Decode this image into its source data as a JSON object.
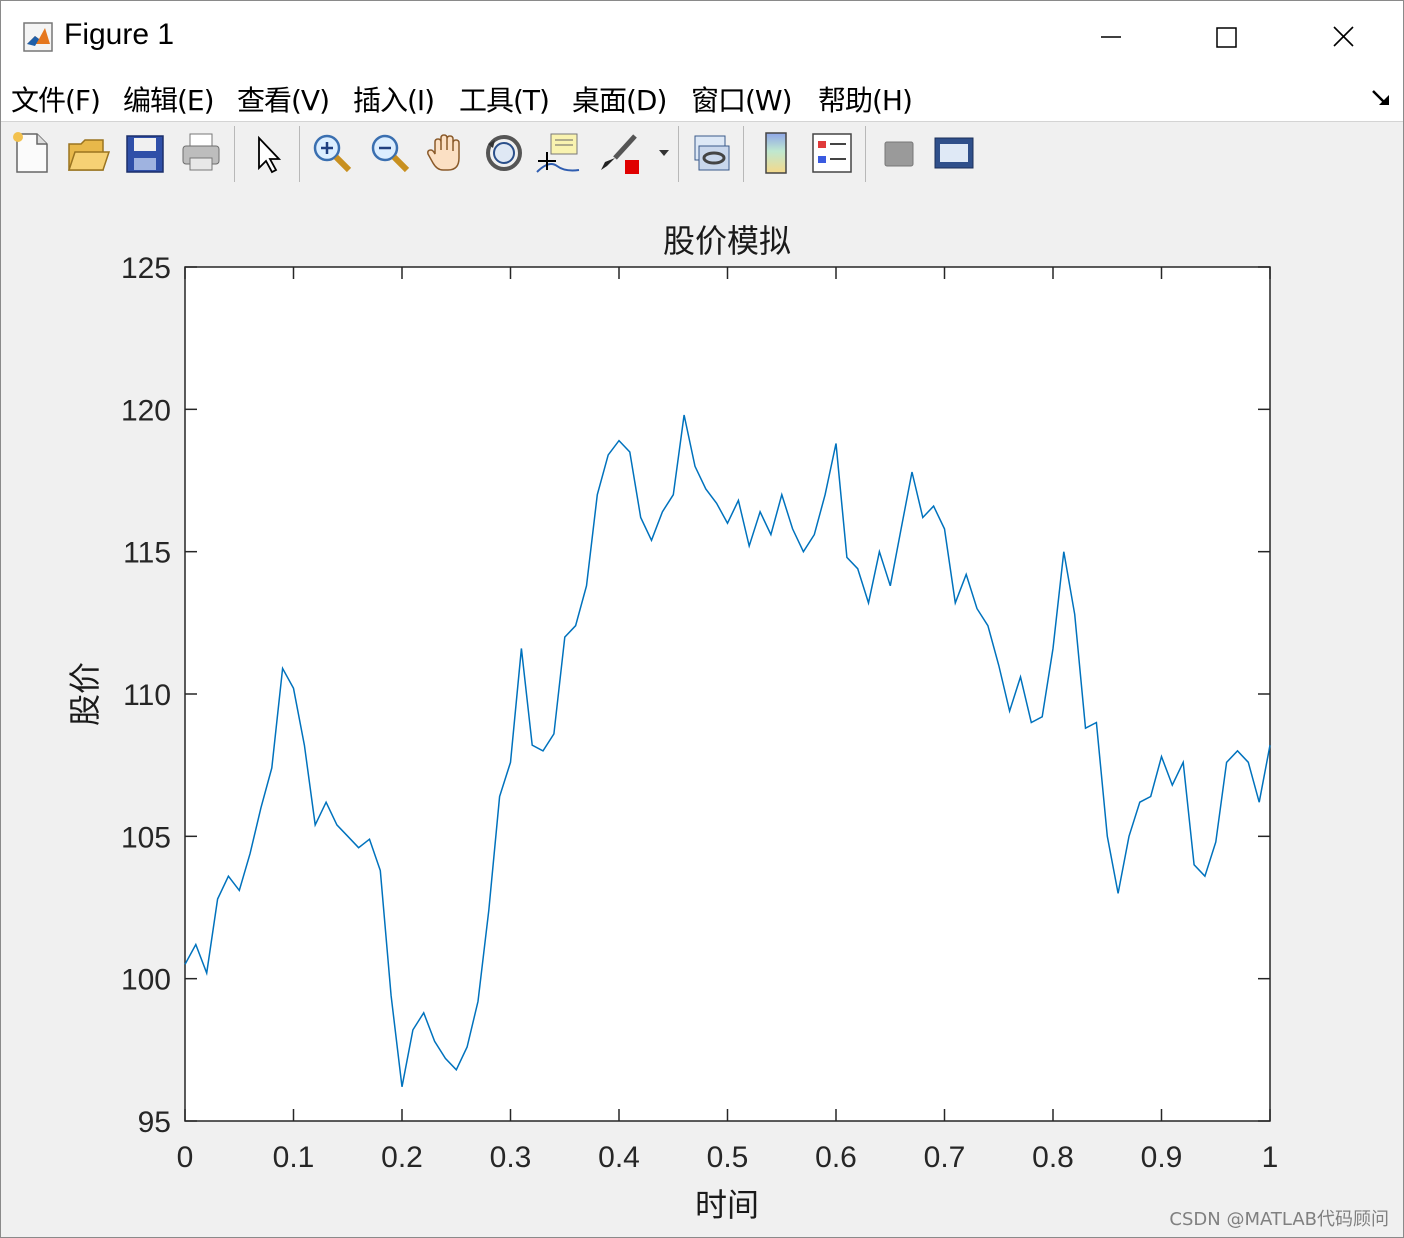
{
  "window": {
    "title": "Figure 1",
    "controls": {
      "minimize": "minimize",
      "maximize": "maximize",
      "close": "close"
    }
  },
  "menu": {
    "items": [
      {
        "label": "文件(F)"
      },
      {
        "label": "编辑(E)"
      },
      {
        "label": "查看(V)"
      },
      {
        "label": "插入(I)"
      },
      {
        "label": "工具(T)"
      },
      {
        "label": "桌面(D)"
      },
      {
        "label": "窗口(W)"
      },
      {
        "label": "帮助(H)"
      }
    ]
  },
  "toolbar": {
    "buttons": [
      {
        "icon": "new-figure-icon"
      },
      {
        "icon": "open-file-icon"
      },
      {
        "icon": "save-icon"
      },
      {
        "icon": "print-icon"
      },
      {
        "icon": "pointer-icon"
      },
      {
        "icon": "zoom-in-icon"
      },
      {
        "icon": "zoom-out-icon"
      },
      {
        "icon": "pan-hand-icon"
      },
      {
        "icon": "rotate-3d-icon"
      },
      {
        "icon": "data-cursor-icon"
      },
      {
        "icon": "brush-icon"
      },
      {
        "icon": "link-plot-icon"
      },
      {
        "icon": "colorbar-icon"
      },
      {
        "icon": "legend-icon"
      },
      {
        "icon": "hide-plot-tools-icon"
      },
      {
        "icon": "show-plot-tools-icon"
      }
    ]
  },
  "chart_data": {
    "type": "line",
    "title": "股价模拟",
    "xlabel": "时间",
    "ylabel": "股价",
    "xlim": [
      0,
      1
    ],
    "ylim": [
      95,
      125
    ],
    "xticks": [
      "0",
      "0.1",
      "0.2",
      "0.3",
      "0.4",
      "0.5",
      "0.6",
      "0.7",
      "0.8",
      "0.9",
      "1"
    ],
    "yticks": [
      "95",
      "100",
      "105",
      "110",
      "115",
      "120",
      "125"
    ],
    "grid": false,
    "line_color": "#0072bd",
    "series": [
      {
        "x": [
          0,
          0.01,
          0.02,
          0.03,
          0.04,
          0.05,
          0.06,
          0.07,
          0.08,
          0.09,
          0.1,
          0.11,
          0.12,
          0.13,
          0.14,
          0.15,
          0.16,
          0.17,
          0.18,
          0.19,
          0.2,
          0.21,
          0.22,
          0.23,
          0.24,
          0.25,
          0.26,
          0.27,
          0.28,
          0.29,
          0.3,
          0.31,
          0.32,
          0.33,
          0.34,
          0.35,
          0.36,
          0.37,
          0.38,
          0.39,
          0.4,
          0.41,
          0.42,
          0.43,
          0.44,
          0.45,
          0.46,
          0.47,
          0.48,
          0.49,
          0.5,
          0.51,
          0.52,
          0.53,
          0.54,
          0.55,
          0.56,
          0.57,
          0.58,
          0.59,
          0.6,
          0.61,
          0.62,
          0.63,
          0.64,
          0.65,
          0.66,
          0.67,
          0.68,
          0.69,
          0.7,
          0.71,
          0.72,
          0.73,
          0.74,
          0.75,
          0.76,
          0.77,
          0.78,
          0.79,
          0.8,
          0.81,
          0.82,
          0.83,
          0.84,
          0.85,
          0.86,
          0.87,
          0.88,
          0.89,
          0.9,
          0.91,
          0.92,
          0.93,
          0.94,
          0.95,
          0.96,
          0.97,
          0.98,
          0.99,
          1.0
        ],
        "values": [
          100.5,
          101.2,
          100.2,
          102.8,
          103.6,
          103.1,
          104.4,
          106.0,
          107.4,
          110.9,
          110.2,
          108.2,
          105.4,
          106.2,
          105.4,
          105.0,
          104.6,
          104.9,
          103.8,
          99.4,
          96.2,
          98.2,
          98.8,
          97.8,
          97.2,
          96.8,
          97.6,
          99.2,
          102.4,
          106.4,
          107.6,
          111.6,
          108.2,
          108.0,
          108.6,
          112.0,
          112.4,
          113.8,
          117.0,
          118.4,
          118.9,
          118.5,
          116.2,
          115.4,
          116.4,
          117.0,
          119.8,
          118.0,
          117.2,
          116.7,
          116.0,
          116.8,
          115.2,
          116.4,
          115.6,
          117.0,
          115.8,
          115.0,
          115.6,
          117.0,
          118.8,
          114.8,
          114.4,
          113.2,
          115.0,
          113.8,
          115.8,
          117.8,
          116.2,
          116.6,
          115.8,
          113.2,
          114.2,
          113.0,
          112.4,
          111.0,
          109.4,
          110.6,
          109.0,
          109.2,
          111.6,
          115.0,
          112.8,
          108.8,
          109.0,
          105.0,
          103.0,
          105.0,
          106.2,
          106.4,
          107.8,
          106.8,
          107.6,
          104.0,
          103.6,
          104.8,
          107.6,
          108.0,
          107.6,
          106.2,
          108.2
        ]
      }
    ]
  },
  "watermark": "CSDN @MATLAB代码顾问"
}
